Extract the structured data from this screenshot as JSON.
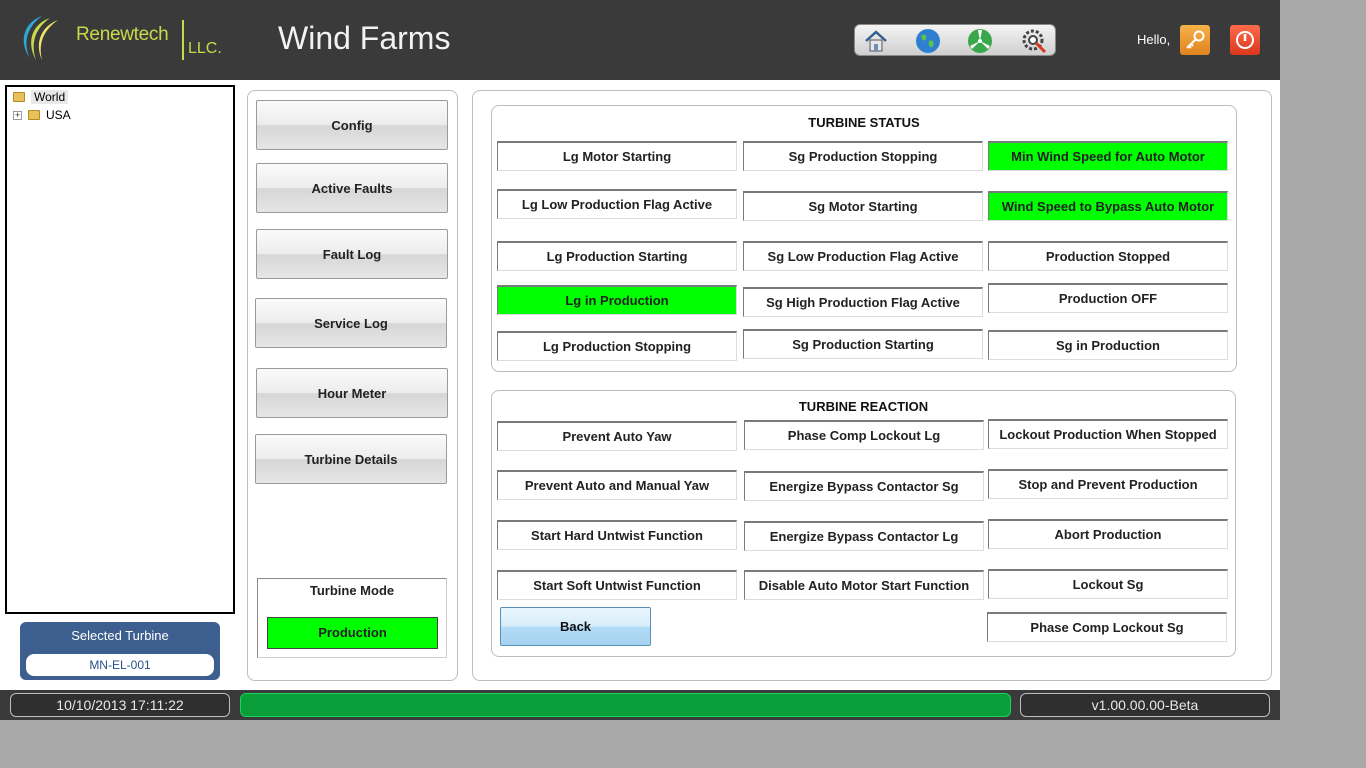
{
  "header": {
    "logo_name": "Renewtech",
    "logo_suffix": "LLC.",
    "title": "Wind Farms",
    "toolbar": [
      {
        "icon": "home-icon"
      },
      {
        "icon": "globe-icon"
      },
      {
        "icon": "turbine-icon"
      },
      {
        "icon": "settings-tools-icon"
      }
    ],
    "greeting": "Hello,"
  },
  "tree": {
    "root": "World",
    "children": [
      "USA"
    ]
  },
  "selected_turbine": {
    "title": "Selected Turbine",
    "value": "MN-EL-001"
  },
  "menu": {
    "buttons": [
      "Config",
      "Active Faults",
      "Fault Log",
      "Service Log",
      "Hour Meter",
      "Turbine Details"
    ],
    "mode_title": "Turbine Mode",
    "mode_value": "Production"
  },
  "turbine_status": {
    "title": "TURBINE STATUS",
    "flags": [
      {
        "label": "Lg Motor Starting",
        "active": false
      },
      {
        "label": "Sg Production Stopping",
        "active": false
      },
      {
        "label": "Min Wind Speed for Auto Motor",
        "active": true
      },
      {
        "label": "Lg Low Production Flag Active",
        "active": false
      },
      {
        "label": "Sg Motor Starting",
        "active": false
      },
      {
        "label": "Wind Speed to Bypass Auto Motor",
        "active": true
      },
      {
        "label": "Lg Production Starting",
        "active": false
      },
      {
        "label": "Sg Low Production Flag Active",
        "active": false
      },
      {
        "label": "Production Stopped",
        "active": false
      },
      {
        "label": "Lg in Production",
        "active": true
      },
      {
        "label": "Sg High Production Flag Active",
        "active": false
      },
      {
        "label": "Production OFF",
        "active": false
      },
      {
        "label": "Lg Production Stopping",
        "active": false
      },
      {
        "label": "Sg Production Starting",
        "active": false
      },
      {
        "label": "Sg in Production",
        "active": false
      }
    ]
  },
  "turbine_reaction": {
    "title": "TURBINE REACTION",
    "flags": [
      {
        "label": "Prevent Auto Yaw",
        "active": false
      },
      {
        "label": "Phase Comp Lockout Lg",
        "active": false
      },
      {
        "label": "Lockout Production When Stopped",
        "active": false
      },
      {
        "label": "Prevent Auto and Manual Yaw",
        "active": false
      },
      {
        "label": "Energize Bypass Contactor Sg",
        "active": false
      },
      {
        "label": "Stop and Prevent Production",
        "active": false
      },
      {
        "label": "Start Hard Untwist Function",
        "active": false
      },
      {
        "label": "Energize Bypass Contactor Lg",
        "active": false
      },
      {
        "label": "Abort Production",
        "active": false
      },
      {
        "label": "Start Soft Untwist Function",
        "active": false
      },
      {
        "label": "Disable Auto Motor Start Function",
        "active": false
      },
      {
        "label": "Lockout Sg",
        "active": false
      },
      {
        "label": "Phase Comp Lockout Sg",
        "active": false
      }
    ],
    "back_label": "Back"
  },
  "statusbar": {
    "datetime": "10/10/2013 17:11:22",
    "progress": 1.0,
    "version": "v1.00.00.00-Beta"
  },
  "colors": {
    "active": "#00ff00",
    "header_bg": "#3a3a3a",
    "logo_green": "#c9d94a",
    "accent_blue": "#3c5f8f"
  }
}
